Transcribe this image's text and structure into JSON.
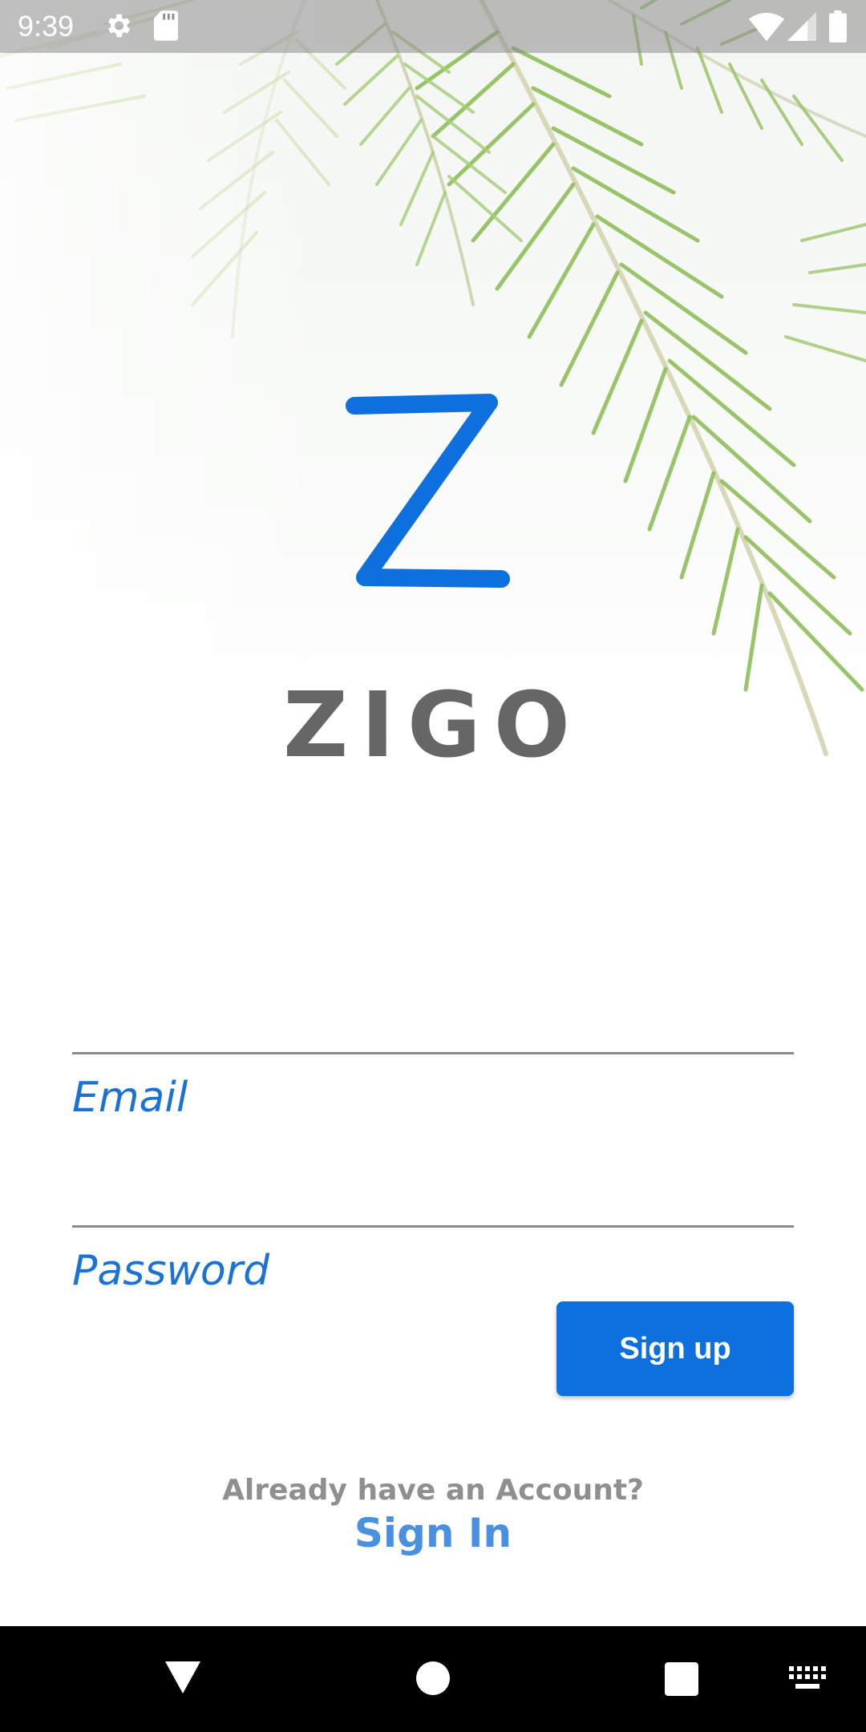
{
  "status_bar": {
    "time": "9:39",
    "icons": [
      "gear-icon",
      "sd-card-icon",
      "wifi-icon",
      "cell-signal-icon",
      "battery-icon"
    ]
  },
  "hero": {
    "background_image": "palm-leaves",
    "logo_letter": "Z",
    "brand_name": "ZIGO"
  },
  "form": {
    "email_label": "Email",
    "email_value": "",
    "password_label": "Password",
    "password_value": "",
    "signup_label": "Sign up"
  },
  "footer": {
    "prompt": "Already have an Account?",
    "signin_label": "Sign In"
  },
  "nav_bar": {
    "icons": [
      "back-icon",
      "home-icon",
      "recents-icon",
      "keyboard-icon"
    ]
  },
  "colors": {
    "accent": "#0e6fde",
    "label": "#1a72d6",
    "link": "#4a90e2",
    "brand_text": "#666666"
  }
}
